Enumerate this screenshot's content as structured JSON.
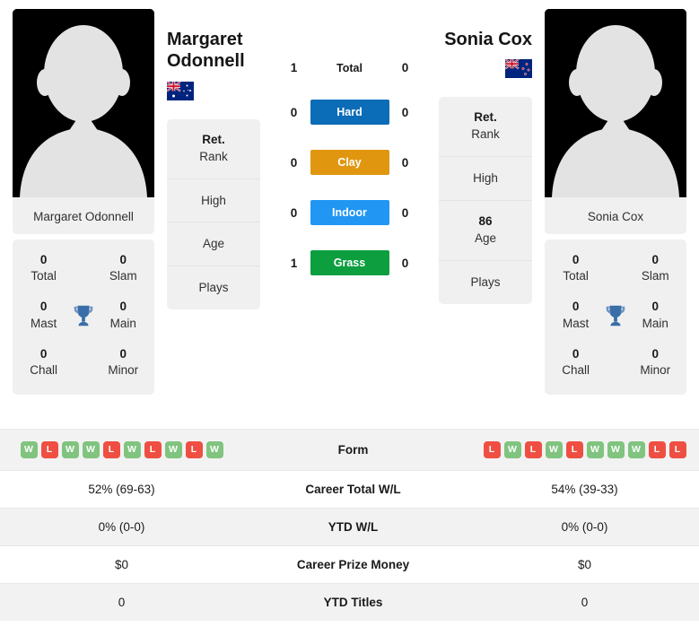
{
  "players": {
    "left": {
      "name": "Margaret Odonnell",
      "display_name": "Margaret Odonnell",
      "flag": "australia-flag",
      "avatar": "player-silhouette-placeholder",
      "titles": {
        "total": "0",
        "total_label": "Total",
        "slam": "0",
        "slam_label": "Slam",
        "mast": "0",
        "mast_label": "Mast",
        "main": "0",
        "main_label": "Main",
        "chall": "0",
        "chall_label": "Chall",
        "minor": "0",
        "minor_label": "Minor"
      },
      "info": {
        "rank_value": "Ret.",
        "rank_label": "Rank",
        "high_value": "",
        "high_label": "High",
        "age_value": "",
        "age_label": "Age",
        "plays_value": "",
        "plays_label": "Plays"
      },
      "form": [
        "W",
        "L",
        "W",
        "W",
        "L",
        "W",
        "L",
        "W",
        "L",
        "W"
      ],
      "career_total_wl": "52% (69-63)",
      "ytd_wl": "0% (0-0)",
      "career_prize_money": "$0",
      "ytd_titles": "0"
    },
    "right": {
      "name": "Sonia Cox",
      "display_name": "Sonia Cox",
      "flag": "new-zealand-flag",
      "avatar": "player-silhouette-placeholder",
      "titles": {
        "total": "0",
        "total_label": "Total",
        "slam": "0",
        "slam_label": "Slam",
        "mast": "0",
        "mast_label": "Mast",
        "main": "0",
        "main_label": "Main",
        "chall": "0",
        "chall_label": "Chall",
        "minor": "0",
        "minor_label": "Minor"
      },
      "info": {
        "rank_value": "Ret.",
        "rank_label": "Rank",
        "high_value": "",
        "high_label": "High",
        "age_value": "86",
        "age_label": "Age",
        "plays_value": "",
        "plays_label": "Plays"
      },
      "form": [
        "L",
        "W",
        "L",
        "W",
        "L",
        "W",
        "W",
        "W",
        "L",
        "L"
      ],
      "career_total_wl": "54% (39-33)",
      "ytd_wl": "0% (0-0)",
      "career_prize_money": "$0",
      "ytd_titles": "0"
    }
  },
  "head_to_head": [
    {
      "label": "Total",
      "left": "1",
      "right": "0",
      "color": "",
      "plain": true
    },
    {
      "label": "Hard",
      "left": "0",
      "right": "0",
      "color": "#0b6cb8",
      "plain": false
    },
    {
      "label": "Clay",
      "left": "0",
      "right": "0",
      "color": "#e0960f",
      "plain": false
    },
    {
      "label": "Indoor",
      "left": "0",
      "right": "0",
      "color": "#2196f3",
      "plain": false
    },
    {
      "label": "Grass",
      "left": "1",
      "right": "0",
      "color": "#0d9e3f",
      "plain": false
    }
  ],
  "stats_rows": [
    {
      "label": "Form"
    },
    {
      "label": "Career Total W/L"
    },
    {
      "label": "YTD W/L"
    },
    {
      "label": "Career Prize Money"
    },
    {
      "label": "YTD Titles"
    }
  ],
  "colors": {
    "trophy": "#3a6ea8",
    "win_badge": "#80c47f",
    "loss_badge": "#ef4f42",
    "card_bg": "#f0f0f0",
    "row_stripe": "#f2f2f2"
  }
}
